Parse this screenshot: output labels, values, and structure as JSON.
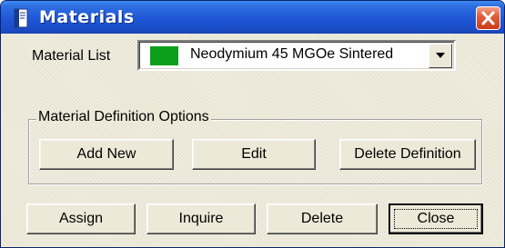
{
  "window": {
    "title": "Materials"
  },
  "material_list": {
    "label": "Material List",
    "selected_value": "Neodymium 45 MGOe Sintered",
    "swatch_color": "#0a9e1c"
  },
  "definition_options": {
    "label": "Material Definition Options",
    "add_new_label": "Add New",
    "edit_label": "Edit",
    "delete_definition_label": "Delete Definition"
  },
  "actions": {
    "assign_label": "Assign",
    "inquire_label": "Inquire",
    "delete_label": "Delete",
    "close_label": "Close"
  },
  "icons": {
    "title_icon": "material-document-icon",
    "close_icon": "close-x-icon",
    "dropdown_icon": "chevron-down-icon"
  }
}
